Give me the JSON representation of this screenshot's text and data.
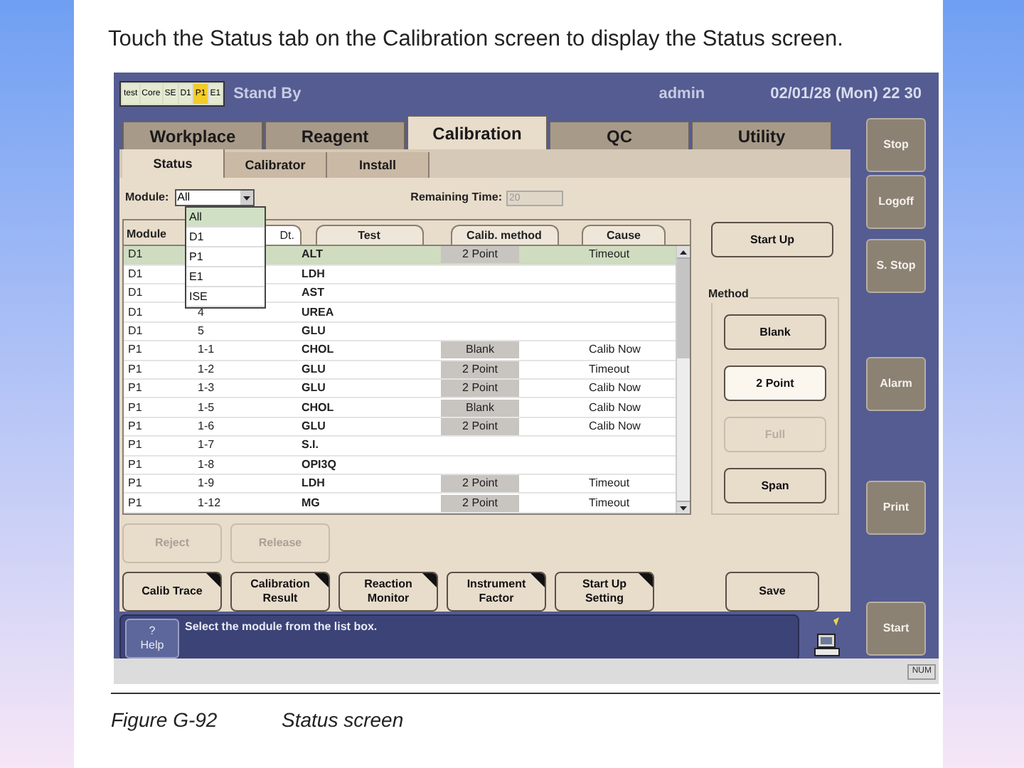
{
  "heading": "Touch the Status tab on the Calibration screen to display the Status screen.",
  "screen": {
    "module_chips": [
      {
        "label": "test",
        "color": "#e4ead2"
      },
      {
        "label": "Core",
        "color": "#e4ead2"
      },
      {
        "label": "SE",
        "color": "#e4ead2"
      },
      {
        "label": "D1",
        "color": "#e4ead2"
      },
      {
        "label": "P1",
        "color": "#f2cc2a"
      },
      {
        "label": "E1",
        "color": "#e4ead2"
      }
    ],
    "status": "Stand By",
    "user": "admin",
    "datetime": "02/01/28 (Mon) 22 30",
    "tabs": [
      {
        "label": "Workplace",
        "selected": false
      },
      {
        "label": "Reagent",
        "selected": false
      },
      {
        "label": "Calibration",
        "selected": true
      },
      {
        "label": "QC",
        "selected": false
      },
      {
        "label": "Utility",
        "selected": false
      }
    ],
    "subtabs": [
      {
        "label": "Status",
        "selected": true
      },
      {
        "label": "Calibrator",
        "selected": false
      },
      {
        "label": "Install",
        "selected": false
      }
    ],
    "module_filter": {
      "label": "Module:",
      "value": "All",
      "expanded": true,
      "options": [
        {
          "label": "All",
          "selected": true
        },
        {
          "label": "D1",
          "selected": false
        },
        {
          "label": "P1",
          "selected": false
        },
        {
          "label": "E1",
          "selected": false
        },
        {
          "label": "ISE",
          "selected": false
        }
      ]
    },
    "remaining_time": {
      "label": "Remaining Time:",
      "value": "20"
    },
    "table": {
      "columns": [
        "Module",
        "Dt.",
        "Test",
        "Calib. method",
        "Cause"
      ],
      "rows": [
        {
          "module": "D1",
          "test": "ALT",
          "method": "2 Point",
          "cause": "Timeout",
          "selected": true
        },
        {
          "module": "D1",
          "test": "LDH",
          "selected": false
        },
        {
          "module": "D1",
          "test": "AST",
          "selected": false
        },
        {
          "module": "D1",
          "no": "4",
          "test": "UREA",
          "selected": false
        },
        {
          "module": "D1",
          "no": "5",
          "test": "GLU",
          "selected": false
        },
        {
          "module": "P1",
          "no": "1-1",
          "test": "CHOL",
          "method": "Blank",
          "cause": "Calib Now",
          "selected": false
        },
        {
          "module": "P1",
          "no": "1-2",
          "test": "GLU",
          "method": "2 Point",
          "cause": "Timeout",
          "selected": false
        },
        {
          "module": "P1",
          "no": "1-3",
          "test": "GLU",
          "method": "2 Point",
          "cause": "Calib Now",
          "selected": false
        },
        {
          "module": "P1",
          "no": "1-5",
          "test": "CHOL",
          "method": "Blank",
          "cause": "Calib Now",
          "selected": false
        },
        {
          "module": "P1",
          "no": "1-6",
          "test": "GLU",
          "method": "2 Point",
          "cause": "Calib Now",
          "selected": false
        },
        {
          "module": "P1",
          "no": "1-7",
          "test": "S.I.",
          "selected": false
        },
        {
          "module": "P1",
          "no": "1-8",
          "test": "OPI3Q",
          "selected": false
        },
        {
          "module": "P1",
          "no": "1-9",
          "test": "LDH",
          "method": "2 Point",
          "cause": "Timeout",
          "selected": false
        },
        {
          "module": "P1",
          "no": "1-12",
          "test": "MG",
          "method": "2 Point",
          "cause": "Timeout",
          "selected": false
        }
      ]
    },
    "start_up_button": "Start Up",
    "method_group": {
      "title": "Method",
      "buttons": [
        {
          "label": "Blank",
          "selected": false,
          "disabled": false
        },
        {
          "label": "2 Point",
          "selected": true,
          "disabled": false
        },
        {
          "label": "Full",
          "selected": false,
          "disabled": true
        },
        {
          "label": "Span",
          "selected": false,
          "disabled": false
        }
      ]
    },
    "action_buttons": [
      {
        "label": "Reject",
        "disabled": true
      },
      {
        "label": "Release",
        "disabled": true
      }
    ],
    "function_buttons": [
      {
        "label": "Calib Trace",
        "submenu": true
      },
      {
        "label": "Calibration Result",
        "submenu": true
      },
      {
        "label": "Reaction Monitor",
        "submenu": true
      },
      {
        "label": "Instrument Factor",
        "submenu": true
      },
      {
        "label": "Start Up Setting",
        "submenu": true
      },
      {
        "label": "Save",
        "submenu": false
      }
    ],
    "help_button": {
      "mark": "?",
      "label": "Help"
    },
    "message": "Select the module from the list box.",
    "side_buttons": [
      "Stop",
      "Logoff",
      "S. Stop",
      "Alarm",
      "Print",
      "Start"
    ],
    "status_strip": "NUM"
  },
  "caption": {
    "number": "Figure G-92",
    "title": "Status screen"
  }
}
